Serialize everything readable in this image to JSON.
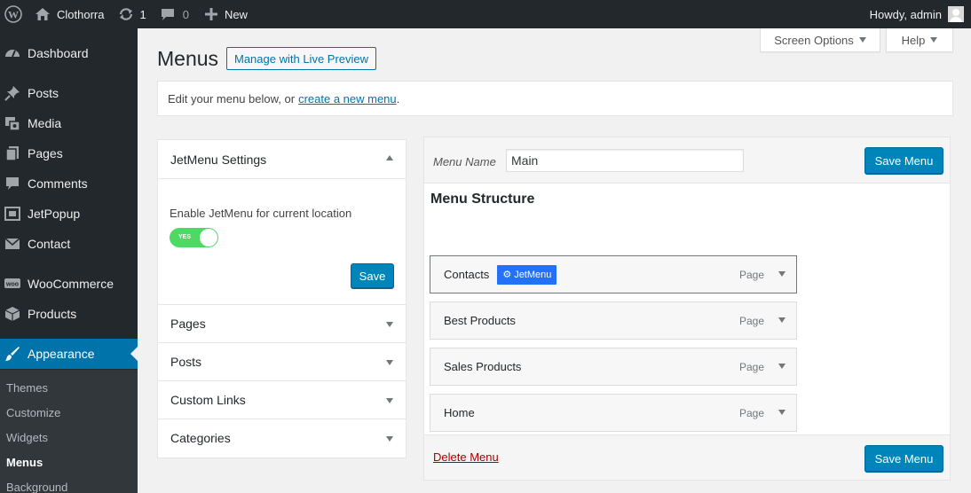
{
  "adminbar": {
    "site_name": "Clothorra",
    "updates_count": "1",
    "comments_count": "0",
    "new_label": "New",
    "greeting": "Howdy, admin"
  },
  "sidebar": {
    "items": [
      {
        "label": "Dashboard"
      },
      {
        "label": "Posts"
      },
      {
        "label": "Media"
      },
      {
        "label": "Pages"
      },
      {
        "label": "Comments"
      },
      {
        "label": "JetPopup"
      },
      {
        "label": "Contact"
      },
      {
        "label": "WooCommerce"
      },
      {
        "label": "Products"
      },
      {
        "label": "Appearance"
      }
    ],
    "submenu": [
      {
        "label": "Themes"
      },
      {
        "label": "Customize"
      },
      {
        "label": "Widgets"
      },
      {
        "label": "Menus"
      },
      {
        "label": "Background"
      }
    ]
  },
  "screen_meta": {
    "screen_options": "Screen Options",
    "help": "Help"
  },
  "page": {
    "title": "Menus",
    "live_preview": "Manage with Live Preview",
    "notice_text": "Edit your menu below, or",
    "notice_link": "create a new menu",
    "notice_end": "."
  },
  "left_panel": {
    "jetmenu_title": "JetMenu Settings",
    "enable_label": "Enable JetMenu for current location",
    "toggle_label": "YES",
    "toggle_on": true,
    "save_label": "Save",
    "sections": [
      {
        "label": "Pages"
      },
      {
        "label": "Posts"
      },
      {
        "label": "Custom Links"
      },
      {
        "label": "Categories"
      }
    ]
  },
  "menu_editor": {
    "menu_name_label": "Menu Name",
    "menu_name_value": "Main",
    "save_menu_label": "Save Menu",
    "structure_title": "Menu Structure",
    "items": [
      {
        "title": "Contacts",
        "type": "Page",
        "badge": "JetMenu"
      },
      {
        "title": "Best Products",
        "type": "Page"
      },
      {
        "title": "Sales Products",
        "type": "Page"
      },
      {
        "title": "Home",
        "type": "Page"
      }
    ],
    "delete_label": "Delete Menu"
  },
  "colors": {
    "accent": "#0073aa",
    "primary_button": "#0085ba",
    "adminbar_bg": "#23282d",
    "toggle_on": "#4cd964",
    "jetmenu_badge": "#2271f6",
    "delete_link": "#aa0000"
  },
  "icons": [
    "wordpress-logo-icon",
    "home-icon",
    "updates-icon",
    "comments-icon",
    "plus-icon",
    "avatar-icon",
    "dashboard-icon",
    "pin-icon",
    "media-icon",
    "pages-icon",
    "comment-bubble-icon",
    "jetpopup-icon",
    "envelope-icon",
    "woocommerce-icon",
    "products-box-icon",
    "paintbrush-icon",
    "gear-icon"
  ]
}
